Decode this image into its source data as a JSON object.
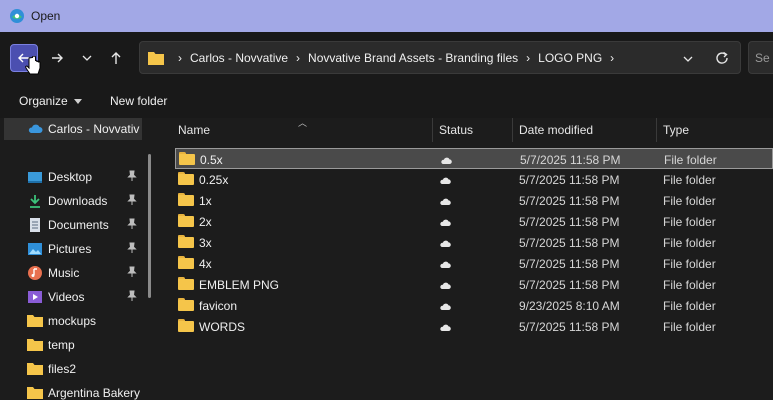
{
  "window": {
    "title": "Open",
    "accent": "#a2a8e6"
  },
  "navigation": {
    "back_icon": "arrow-left-icon",
    "forward_icon": "arrow-right-icon",
    "recent_icon": "chevron-down-icon",
    "up_icon": "arrow-up-icon"
  },
  "address": {
    "crumbs": [
      "Carlos - Novvative",
      "Novvative Brand Assets - Branding files",
      "LOGO PNG"
    ]
  },
  "search": {
    "placeholder": "Se"
  },
  "toolbar": {
    "organize_label": "Organize",
    "new_folder_label": "New folder"
  },
  "sidebar": {
    "items": [
      {
        "label": "Carlos - Novvativ",
        "icon": "cloud-icon",
        "pinned": false
      },
      {
        "label": "Desktop",
        "icon": "desktop-icon",
        "pinned": true
      },
      {
        "label": "Downloads",
        "icon": "download-icon",
        "pinned": true
      },
      {
        "label": "Documents",
        "icon": "documents-icon",
        "pinned": true
      },
      {
        "label": "Pictures",
        "icon": "pictures-icon",
        "pinned": true
      },
      {
        "label": "Music",
        "icon": "music-icon",
        "pinned": true
      },
      {
        "label": "Videos",
        "icon": "videos-icon",
        "pinned": true
      },
      {
        "label": "mockups",
        "icon": "folder-icon",
        "pinned": false
      },
      {
        "label": "temp",
        "icon": "folder-icon",
        "pinned": false
      },
      {
        "label": "files2",
        "icon": "folder-icon",
        "pinned": false
      },
      {
        "label": "Argentina Bakery",
        "icon": "folder-icon",
        "pinned": false
      }
    ]
  },
  "filelist": {
    "columns": {
      "name": "Name",
      "status": "Status",
      "date": "Date modified",
      "type": "Type"
    },
    "rows": [
      {
        "name": "0.5x",
        "status": "cloud-icon",
        "date": "5/7/2025 11:58 PM",
        "type": "File folder",
        "selected": true
      },
      {
        "name": "0.25x",
        "status": "cloud-icon",
        "date": "5/7/2025 11:58 PM",
        "type": "File folder"
      },
      {
        "name": "1x",
        "status": "cloud-icon",
        "date": "5/7/2025 11:58 PM",
        "type": "File folder"
      },
      {
        "name": "2x",
        "status": "cloud-icon",
        "date": "5/7/2025 11:58 PM",
        "type": "File folder"
      },
      {
        "name": "3x",
        "status": "cloud-icon",
        "date": "5/7/2025 11:58 PM",
        "type": "File folder"
      },
      {
        "name": "4x",
        "status": "cloud-icon",
        "date": "5/7/2025 11:58 PM",
        "type": "File folder"
      },
      {
        "name": "EMBLEM PNG",
        "status": "cloud-icon",
        "date": "5/7/2025 11:58 PM",
        "type": "File folder"
      },
      {
        "name": "favicon",
        "status": "cloud-icon",
        "date": "9/23/2025 8:10 AM",
        "type": "File folder"
      },
      {
        "name": "WORDS",
        "status": "cloud-icon",
        "date": "5/7/2025 11:58 PM",
        "type": "File folder"
      }
    ]
  }
}
